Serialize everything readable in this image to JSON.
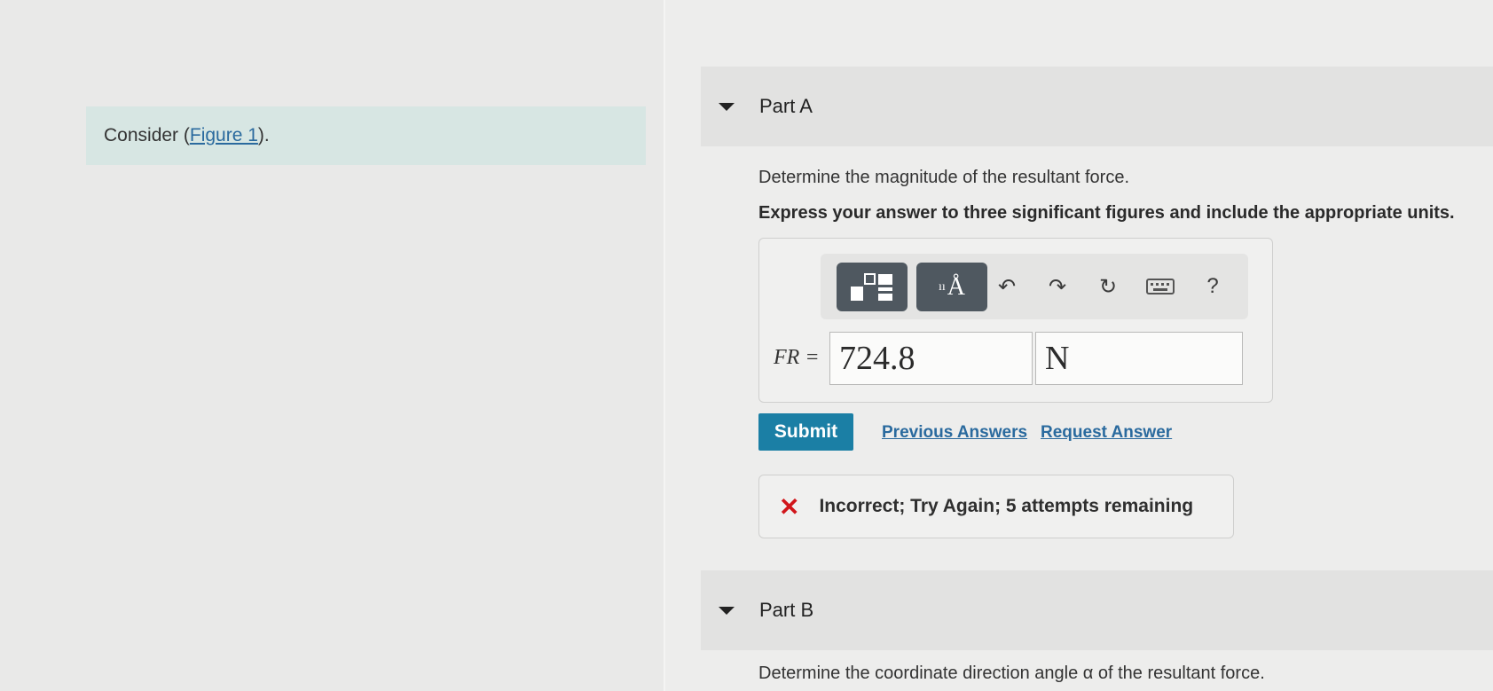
{
  "left": {
    "consider_prefix": "Consider (",
    "figure_link": "Figure 1",
    "consider_suffix": ")."
  },
  "part_a": {
    "title": "Part A",
    "question": "Determine the magnitude of the resultant force.",
    "instruction": "Express your answer to three significant figures and include the appropriate units.",
    "toolbar": {
      "icons": [
        "templates-icon",
        "units-icon",
        "undo-icon",
        "redo-icon",
        "reset-icon",
        "keyboard-icon",
        "help-icon"
      ],
      "help_label": "?"
    },
    "variable_label": "FR =",
    "value": "724.8",
    "unit": "N",
    "submit_label": "Submit",
    "previous_answers_label": "Previous Answers",
    "request_answer_label": "Request Answer",
    "feedback": "Incorrect; Try Again; 5 attempts remaining"
  },
  "part_b": {
    "title": "Part B",
    "question": "Determine the coordinate direction angle α of the resultant force."
  },
  "colors": {
    "accent": "#1b7fa5",
    "link": "#2a6a9e",
    "error": "#d1161b",
    "consider_bg": "#d7e6e3"
  }
}
